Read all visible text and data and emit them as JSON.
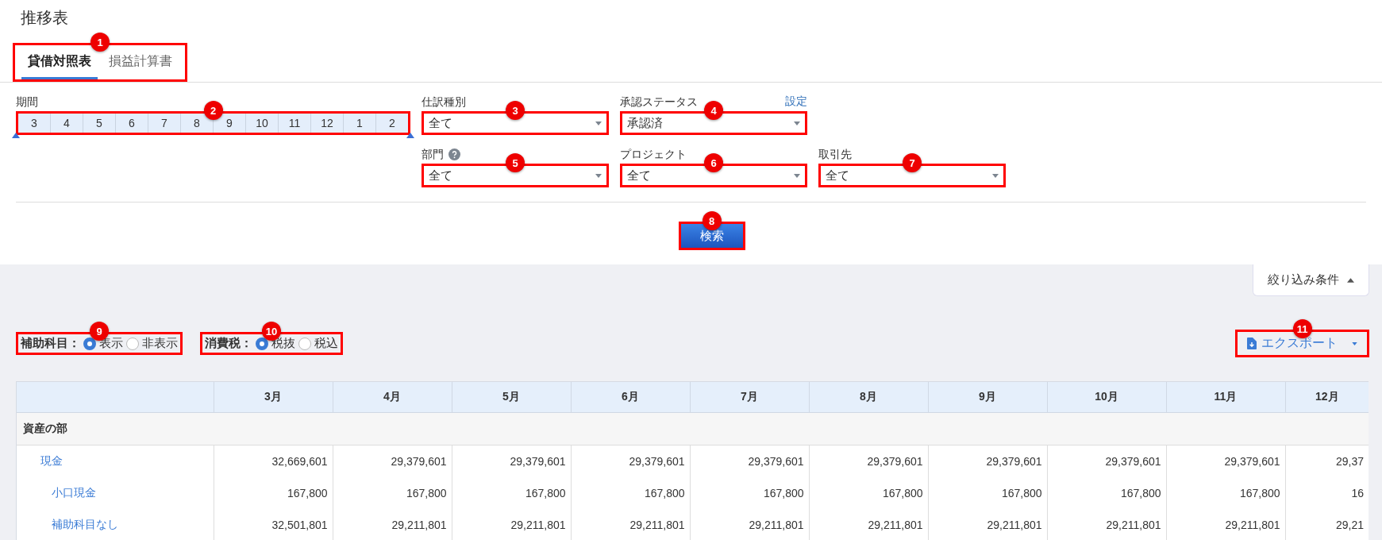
{
  "page": {
    "title": "推移表"
  },
  "tabs_callout": "1",
  "tabs": [
    {
      "label": "貸借対照表",
      "selected": true
    },
    {
      "label": "損益計算書",
      "selected": false
    }
  ],
  "period": {
    "label": "期間",
    "callout": "2",
    "months": [
      "3",
      "4",
      "5",
      "6",
      "7",
      "8",
      "9",
      "10",
      "11",
      "12",
      "1",
      "2"
    ]
  },
  "selects": [
    {
      "label": "仕訳種別",
      "value": "全て",
      "callout": "3",
      "kind": "plain"
    },
    {
      "label": "承認ステータス",
      "value": "承認済",
      "callout": "4",
      "kind": "link",
      "link": "設定"
    },
    {
      "label": "部門",
      "value": "全て",
      "callout": "5",
      "kind": "help"
    },
    {
      "label": "プロジェクト",
      "value": "全て",
      "callout": "6",
      "kind": "plain"
    },
    {
      "label": "取引先",
      "value": "全て",
      "callout": "7",
      "kind": "plain"
    }
  ],
  "search_button": {
    "label": "検索",
    "callout": "8"
  },
  "filter_toggle": {
    "label": "絞り込み条件",
    "expanded": true
  },
  "radio_groups": [
    {
      "label": "補助科目：",
      "callout": "9",
      "options": [
        {
          "label": "表示",
          "selected": true
        },
        {
          "label": "非表示",
          "selected": false
        }
      ]
    },
    {
      "label": "消費税：",
      "callout": "10",
      "options": [
        {
          "label": "税抜",
          "selected": true
        },
        {
          "label": "税込",
          "selected": false
        }
      ]
    }
  ],
  "export_button": {
    "label": "エクスポート",
    "callout": "11"
  },
  "table": {
    "columns": [
      "3月",
      "4月",
      "5月",
      "6月",
      "7月",
      "8月",
      "9月",
      "10月",
      "11月",
      "12月"
    ],
    "rows": [
      {
        "kind": "section",
        "label": "資産の部"
      },
      {
        "kind": "account",
        "label": "現金",
        "values": [
          "32,669,601",
          "29,379,601",
          "29,379,601",
          "29,379,601",
          "29,379,601",
          "29,379,601",
          "29,379,601",
          "29,379,601",
          "29,379,601",
          "29,37"
        ]
      },
      {
        "kind": "sub_account",
        "label": "小口現金",
        "values": [
          "167,800",
          "167,800",
          "167,800",
          "167,800",
          "167,800",
          "167,800",
          "167,800",
          "167,800",
          "167,800",
          "16"
        ]
      },
      {
        "kind": "sub_account",
        "label": "補助科目なし",
        "values": [
          "32,501,801",
          "29,211,801",
          "29,211,801",
          "29,211,801",
          "29,211,801",
          "29,211,801",
          "29,211,801",
          "29,211,801",
          "29,211,801",
          "29,21"
        ]
      }
    ]
  }
}
